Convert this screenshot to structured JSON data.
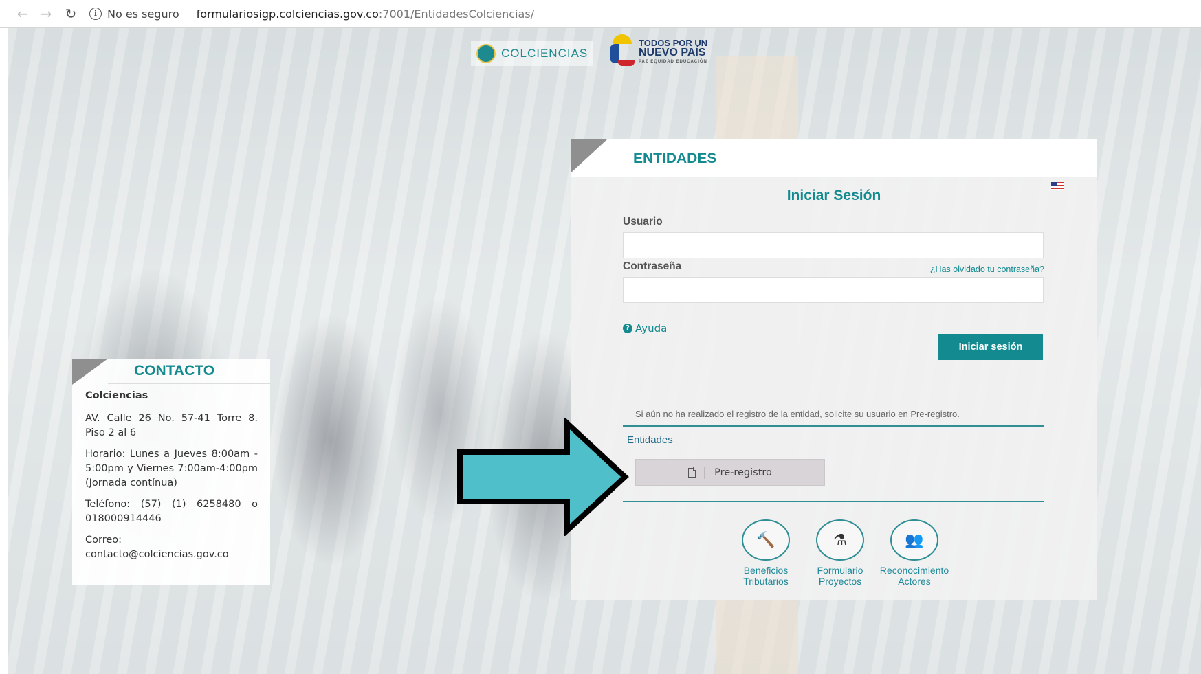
{
  "browser": {
    "security_text": "No es seguro",
    "url_host": "formulariosigp.colciencias.gov.co",
    "url_path": ":7001/EntidadesColciencias/"
  },
  "logos": {
    "colciencias": "COLCIENCIAS",
    "pais_line1": "TODOS POR UN",
    "pais_line2": "NUEVO PAÍS",
    "pais_line3": "PAZ  EQUIDAD  EDUCACIÓN"
  },
  "contact": {
    "title": "CONTACTO",
    "name": "Colciencias",
    "address": "AV. Calle 26 No. 57-41 Torre 8. Piso 2 al 6",
    "hours": "Horario: Lunes a Jueves 8:00am - 5:00pm y Viernes 7:00am-4:00pm (Jornada contínua)",
    "phone": "Teléfono: (57) (1) 6258480 o 018000914446",
    "email_label": "Correo:",
    "email": "contacto@colciencias.gov.co"
  },
  "login": {
    "header": "ENTIDADES",
    "heading": "Iniciar Sesión",
    "user_label": "Usuario",
    "user_value": "",
    "password_label": "Contraseña",
    "password_value": "",
    "forgot_link": "¿Has olvidado tu contraseña?",
    "help_link": "Ayuda",
    "submit_label": "Iniciar sesión",
    "prereg_note": "Si aún no ha realizado el registro de la entidad, solicite su usuario en Pre-registro.",
    "entidades_label": "Entidades",
    "prereg_button": "Pre-registro",
    "quick_links": [
      {
        "line1": "Beneficios",
        "line2": "Tributarios",
        "icon": "gavel-icon"
      },
      {
        "line1": "Formulario",
        "line2": "Proyectos",
        "icon": "flask-icon"
      },
      {
        "line1": "Reconocimiento",
        "line2": "Actores",
        "icon": "users-icon"
      }
    ]
  },
  "colors": {
    "accent": "#128a8f",
    "arrow_fill": "#4fbfc9"
  }
}
